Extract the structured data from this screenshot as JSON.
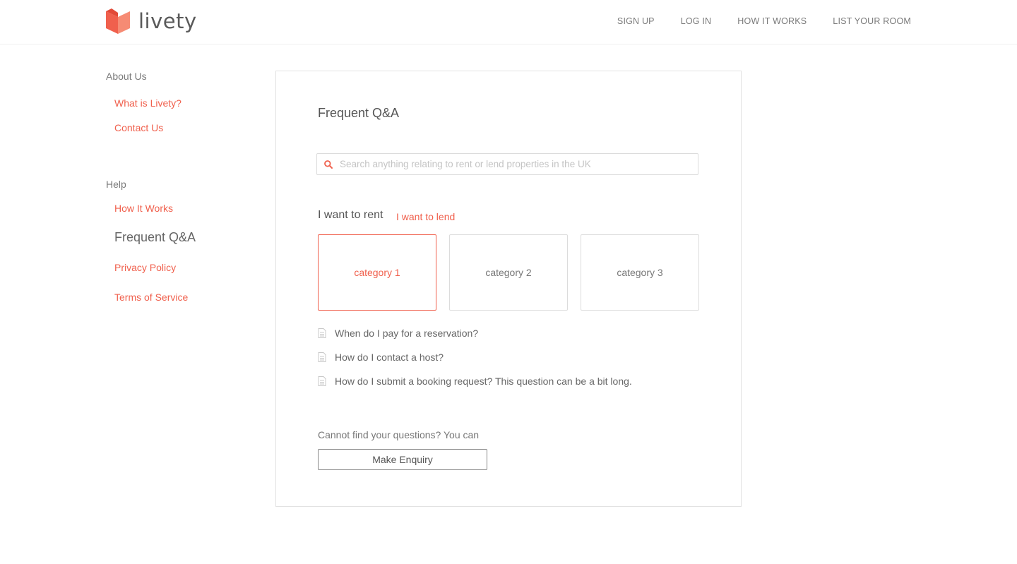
{
  "brand": {
    "name": "livety",
    "color": "#f0604d"
  },
  "nav": {
    "items": [
      "SIGN UP",
      "LOG IN",
      "HOW IT WORKS",
      "LIST YOUR ROOM"
    ]
  },
  "sidebar": {
    "about_heading": "About Us",
    "about_links": [
      "What is Livety?",
      "Contact Us"
    ],
    "help_heading": "Help",
    "help_links": [
      "How It Works",
      "Frequent Q&A",
      "Privacy Policy",
      "Terms of Service"
    ],
    "current": "Frequent Q&A"
  },
  "main": {
    "title": "Frequent Q&A",
    "search_placeholder": "Search anything relating to rent or lend properties in the UK",
    "search_value": "",
    "tabs": {
      "rent": "I want to rent",
      "lend": "I want to lend",
      "active": "rent"
    },
    "categories": [
      {
        "label": "category 1",
        "active": true
      },
      {
        "label": "category 2",
        "active": false
      },
      {
        "label": "category 3",
        "active": false
      }
    ],
    "questions": [
      "When do I pay for a reservation?",
      "How do I contact a host?",
      "How do I submit a booking request? This question can be a bit long."
    ],
    "enquiry_text": "Cannot find your questions?  You can",
    "enquiry_button": "Make Enquiry"
  },
  "icons": {
    "search": "search-icon",
    "document": "document-icon",
    "logo": "logo-mark-icon"
  }
}
